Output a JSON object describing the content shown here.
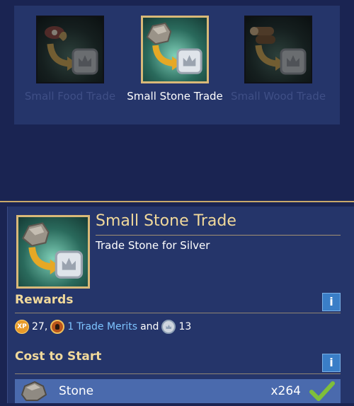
{
  "trade_options": [
    {
      "label": "Small Food Trade",
      "state": "dim",
      "icon": "meat-to-silver-icon"
    },
    {
      "label": "Small Stone Trade",
      "state": "selected",
      "icon": "stone-to-silver-icon"
    },
    {
      "label": "Small Wood Trade",
      "state": "dim",
      "icon": "wood-to-silver-icon"
    }
  ],
  "detail": {
    "title": "Small Stone Trade",
    "description": "Trade Stone for Silver"
  },
  "rewards": {
    "heading": "Rewards",
    "info_label": "i",
    "xp_badge": "XP",
    "xp_value": "27,",
    "merit_count": "1",
    "merit_label": "Trade Merits",
    "conjunction": "and",
    "silver_value": "13"
  },
  "cost": {
    "heading": "Cost to Start",
    "info_label": "i",
    "items": [
      {
        "name": "Stone",
        "quantity": "x264",
        "met": true
      }
    ]
  },
  "colors": {
    "background": "#1a2452",
    "panel": "#25356a",
    "gold_accent": "#d9b978",
    "title_gold": "#f1d99b",
    "link_blue": "#7ec4ff",
    "info_blue": "#3a7ec7",
    "cost_row": "#4a6aad",
    "check_green": "#7fbf3a"
  }
}
